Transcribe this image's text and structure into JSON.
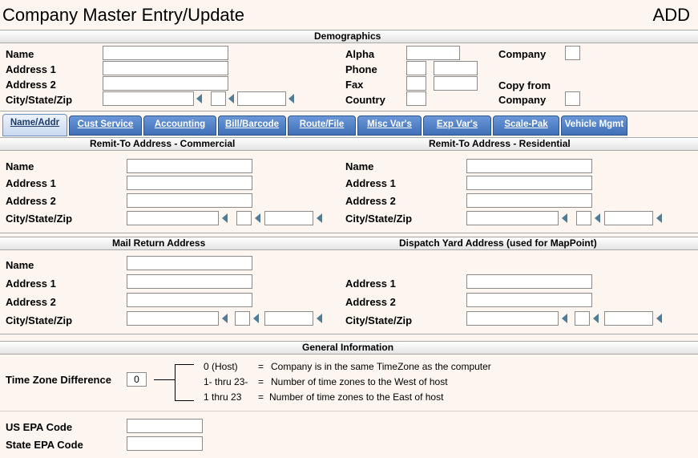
{
  "window": {
    "title": "Company Master Entry/Update",
    "mode": "ADD"
  },
  "demographics": {
    "header": "Demographics",
    "name_label": "Name",
    "address1_label": "Address 1",
    "address2_label": "Address 2",
    "csz_label": "City/State/Zip",
    "alpha_label": "Alpha",
    "phone_label": "Phone",
    "fax_label": "Fax",
    "country_label": "Country",
    "company_label": "Company",
    "copy_from_label": "Copy from",
    "copy_company_label": "Company"
  },
  "tabs": [
    {
      "label": "Name/Addr"
    },
    {
      "label": "Cust Service"
    },
    {
      "label": "Accounting"
    },
    {
      "label": "Bill/Barcode"
    },
    {
      "label": "Route/File"
    },
    {
      "label": "Misc Var's"
    },
    {
      "label": "Exp Var's"
    },
    {
      "label": "Scale-Pak"
    },
    {
      "label": "Vehicle Mgmt"
    }
  ],
  "remit": {
    "commercial_header": "Remit-To Address - Commercial",
    "residential_header": "Remit-To Address - Residential",
    "name_label": "Name",
    "address1_label": "Address 1",
    "address2_label": "Address 2",
    "csz_label": "City/State/Zip"
  },
  "mail": {
    "mail_header": "Mail Return Address",
    "dispatch_header": "Dispatch Yard Address  (used for MapPoint)",
    "name_label": "Name",
    "address1_label": "Address 1",
    "address2_label": "Address 2",
    "csz_label": "City/State/Zip"
  },
  "general": {
    "header": "General Information",
    "tz_label": "Time Zone Difference",
    "tz_value": "0",
    "tz_notes": [
      {
        "code": "0 (Host)",
        "eq": "=",
        "desc": "Company is in the same TimeZone as the computer"
      },
      {
        "code": "1- thru 23-",
        "eq": "=",
        "desc": "Number of time zones to the West of host"
      },
      {
        "code": "1  thru 23",
        "eq": "=",
        "desc": "Number of time zones to the East of host"
      }
    ],
    "us_epa_label": "US EPA Code",
    "state_epa_label": "State EPA Code"
  }
}
